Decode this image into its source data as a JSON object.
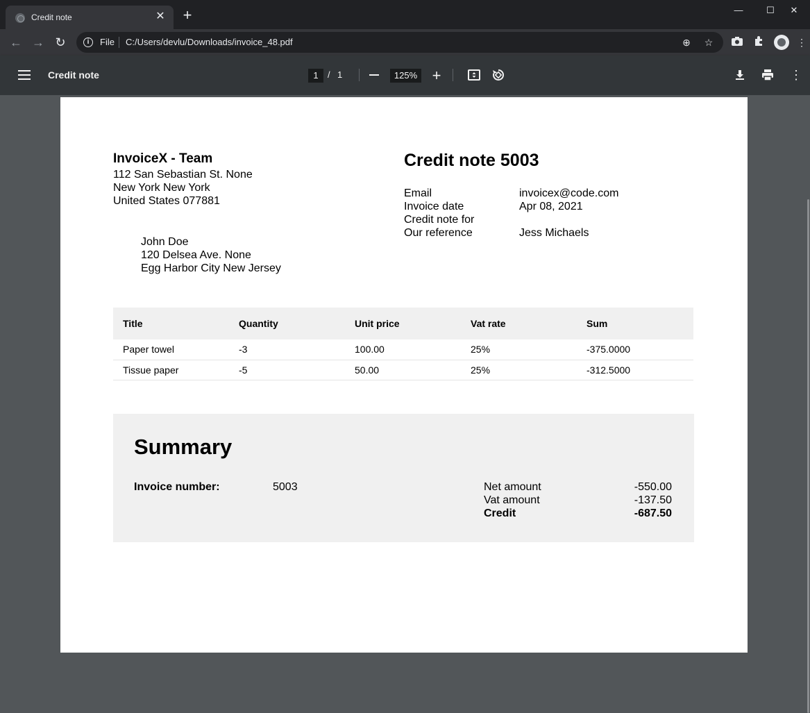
{
  "browser": {
    "tab_title": "Credit note",
    "scheme": "File",
    "url": "C:/Users/devlu/Downloads/invoice_48.pdf"
  },
  "pdf_toolbar": {
    "title": "Credit note",
    "page_current": "1",
    "page_separator": "/",
    "page_total": "1",
    "zoom": "125%"
  },
  "document": {
    "sender": {
      "name": "InvoiceX - Team",
      "address": [
        "112 San Sebastian St. None",
        "New York New York",
        "United States 077881"
      ]
    },
    "recipient": {
      "lines": [
        "John Doe",
        "120 Delsea Ave. None",
        "Egg Harbor City New Jersey"
      ]
    },
    "title": "Credit note 5003",
    "meta": [
      {
        "label": "Email",
        "value": "invoicex@code.com"
      },
      {
        "label": "Invoice date",
        "value": "Apr 08, 2021"
      },
      {
        "label": "Credit note for",
        "value": ""
      },
      {
        "label": "Our reference",
        "value": "Jess Michaels"
      }
    ],
    "table": {
      "headers": [
        "Title",
        "Quantity",
        "Unit price",
        "Vat rate",
        "Sum"
      ],
      "rows": [
        [
          "Paper towel",
          "-3",
          "100.00",
          "25%",
          "-375.0000"
        ],
        [
          "Tissue paper",
          "-5",
          "50.00",
          "25%",
          "-312.5000"
        ]
      ]
    },
    "summary": {
      "title": "Summary",
      "invoice_number_label": "Invoice number:",
      "invoice_number": "5003",
      "net_label": "Net amount",
      "net_value": "-550.00",
      "vat_label": "Vat amount",
      "vat_value": "-137.50",
      "credit_label": "Credit",
      "credit_value": "-687.50"
    }
  }
}
